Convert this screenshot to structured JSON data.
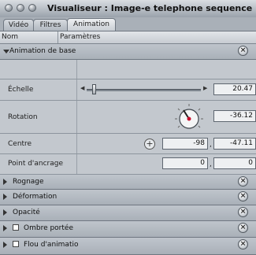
{
  "window": {
    "title": "Visualiseur : Image-e telephone sequence"
  },
  "tabs": [
    {
      "label": "Vidéo"
    },
    {
      "label": "Filtres"
    },
    {
      "label": "Animation"
    }
  ],
  "columns": {
    "name": "Nom",
    "params": "Paramètres"
  },
  "base_section": {
    "label": "Animation de base",
    "reset": "×"
  },
  "params": {
    "scale": {
      "label": "Échelle",
      "value": "20.47"
    },
    "rotation": {
      "label": "Rotation",
      "value": "-36.12"
    },
    "center": {
      "label": "Centre",
      "x": "-98",
      "y": "-47.11"
    },
    "anchor": {
      "label": "Point d'ancrage",
      "x": "0",
      "y": "0"
    }
  },
  "sections": [
    {
      "label": "Rognage"
    },
    {
      "label": "Déformation"
    },
    {
      "label": "Opacité"
    },
    {
      "label": "Ombre portée"
    },
    {
      "label": "Flou d'animatio"
    }
  ],
  "reset_glyph": "×",
  "crosshair_glyph": "+",
  "comma": ","
}
